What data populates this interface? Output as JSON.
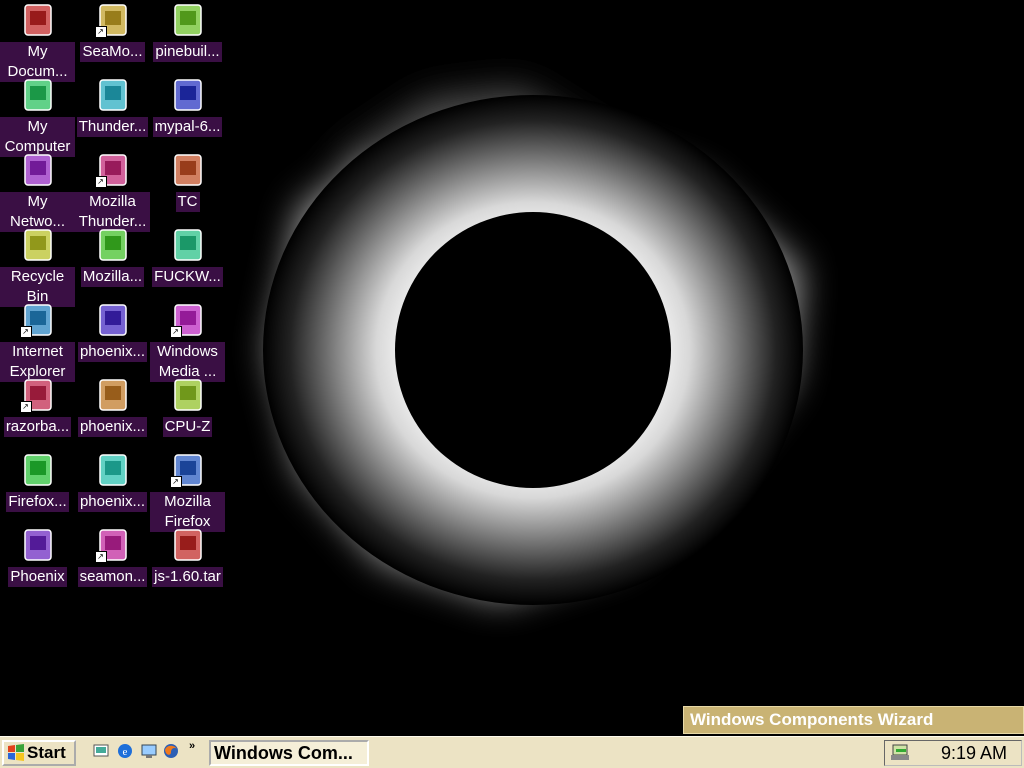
{
  "desktop": {
    "icons": [
      {
        "label": "My Docum...",
        "icon": "my-documents-icon"
      },
      {
        "label": "SeaMo...",
        "icon": "seamonkey-icon"
      },
      {
        "label": "pinebuil...",
        "icon": "pinebuild-icon"
      },
      {
        "label": "My Computer",
        "icon": "my-computer-icon"
      },
      {
        "label": "Thunder...",
        "icon": "thunderbird-installer-icon"
      },
      {
        "label": "mypal-6...",
        "icon": "mypal-file-icon"
      },
      {
        "label": "My Netwo...",
        "icon": "my-network-icon"
      },
      {
        "label": "Mozilla Thunder...",
        "icon": "mozilla-thunderbird-icon"
      },
      {
        "label": "TC",
        "icon": "tc-window-icon"
      },
      {
        "label": "Recycle Bin",
        "icon": "recycle-bin-icon"
      },
      {
        "label": "Mozilla...",
        "icon": "mozilla-file-icon"
      },
      {
        "label": "FUCKW...",
        "icon": "installer-icon"
      },
      {
        "label": "Internet Explorer",
        "icon": "internet-explorer-icon"
      },
      {
        "label": "phoenix...",
        "icon": "phoenix-file-icon"
      },
      {
        "label": "Windows Media ...",
        "icon": "windows-media-icon"
      },
      {
        "label": "razorba...",
        "icon": "razorback-icon"
      },
      {
        "label": "phoenix...",
        "icon": "phoenix-file-icon-2"
      },
      {
        "label": "CPU-Z",
        "icon": "cpuz-window-icon"
      },
      {
        "label": "Firefox...",
        "icon": "firefox-installer-icon"
      },
      {
        "label": "phoenix...",
        "icon": "phoenix-archive-icon"
      },
      {
        "label": "Mozilla Firefox",
        "icon": "mozilla-firefox-icon"
      },
      {
        "label": "Phoenix",
        "icon": "phoenix-app-icon"
      },
      {
        "label": "seamon...",
        "icon": "seamonkey-installer-icon"
      },
      {
        "label": "js-1.60.tar",
        "icon": "js-tar-file-icon"
      }
    ]
  },
  "taskbar": {
    "start_label": "Start",
    "task_label": "Windows Com...",
    "clock": "9:19 AM"
  },
  "balloon": {
    "title": "Windows Components Wizard"
  },
  "colors": {
    "taskbar": "#ece3c4",
    "icon_label_bg": "#3a0f44",
    "balloon": "#c9b374"
  }
}
